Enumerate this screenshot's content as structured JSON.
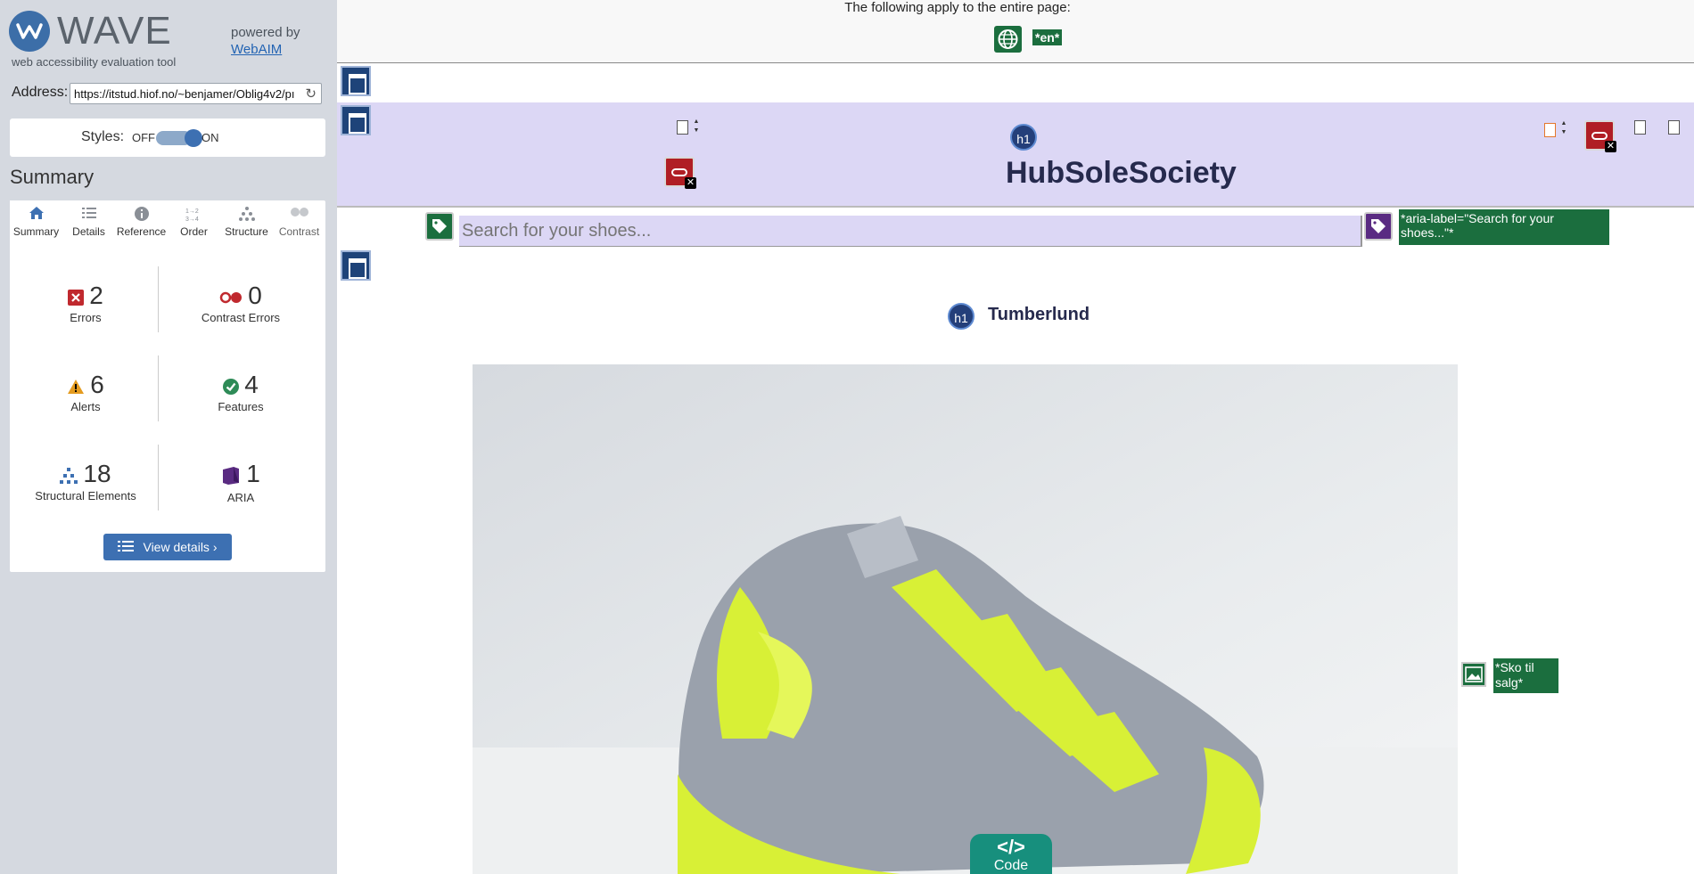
{
  "sidebar": {
    "brand": "WAVE",
    "subtitle": "web accessibility evaluation tool",
    "powered_by": "powered by",
    "powered_link": "WebAIM",
    "address_label": "Address:",
    "address_value": "https://itstud.hiof.no/~benjamer/Oblig4v2/pı",
    "styles_label": "Styles:",
    "styles_off": "OFF",
    "styles_on": "ON",
    "styles_enabled": true,
    "summary_heading": "Summary",
    "tabs": [
      {
        "label": "Summary",
        "icon": "home-icon",
        "active": true
      },
      {
        "label": "Details",
        "icon": "list-icon",
        "active": false
      },
      {
        "label": "Reference",
        "icon": "info-icon",
        "active": false
      },
      {
        "label": "Order",
        "icon": "order-icon",
        "active": false
      },
      {
        "label": "Structure",
        "icon": "structure-icon",
        "active": false
      },
      {
        "label": "Contrast",
        "icon": "contrast-icon",
        "active": false
      }
    ],
    "stats": [
      {
        "count": "2",
        "label": "Errors",
        "icon": "error-icon",
        "color": "#c0292e"
      },
      {
        "count": "0",
        "label": "Contrast Errors",
        "icon": "contrast-error-icon",
        "color": "#c0292e"
      },
      {
        "count": "6",
        "label": "Alerts",
        "icon": "alert-icon",
        "color": "#e49b1f"
      },
      {
        "count": "4",
        "label": "Features",
        "icon": "feature-icon",
        "color": "#2e8b57"
      },
      {
        "count": "18",
        "label": "Structural Elements",
        "icon": "structure-icon",
        "color": "#3d70b2"
      },
      {
        "count": "1",
        "label": "ARIA",
        "icon": "aria-icon",
        "color": "#5a2b82"
      }
    ],
    "view_details": "View details ›"
  },
  "page": {
    "applies_text": "The following apply to the entire page:",
    "lang_tag": "*en*",
    "h1_badge": "h1",
    "site_title": "HubSoleSociety",
    "search_placeholder": "Search for your shoes...",
    "aria_label_tag": "*aria-label=\"Search for your shoes...\"*",
    "product_title": "Tumberlund",
    "alt_tag": "*Sko til salg*",
    "code_button": "Code",
    "code_glyph": "</>"
  },
  "colors": {
    "accent": "#3d70b2",
    "header_band": "#dcd7f5",
    "feature_green": "#1b6e3e",
    "error_red": "#b01e24",
    "code_teal": "#178f7d"
  }
}
